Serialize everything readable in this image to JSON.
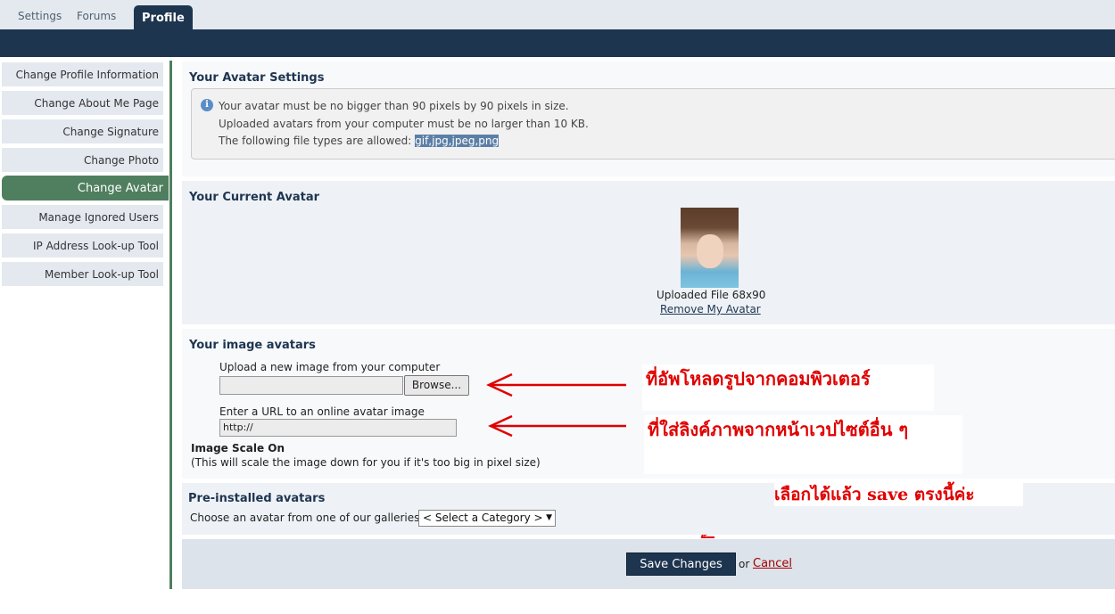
{
  "tabs": [
    {
      "label": "Settings"
    },
    {
      "label": "Forums"
    },
    {
      "label": "Profile",
      "active": true
    }
  ],
  "sidebar": {
    "items": [
      {
        "label": "Change Profile Information"
      },
      {
        "label": "Change About Me Page"
      },
      {
        "label": "Change Signature"
      },
      {
        "label": "Change Photo"
      },
      {
        "label": "Change Avatar",
        "active": true
      },
      {
        "label": "Manage Ignored Users"
      },
      {
        "label": "IP Address Look-up Tool"
      },
      {
        "label": "Member Look-up Tool"
      }
    ]
  },
  "avatar_settings": {
    "title": "Your Avatar Settings",
    "line1": "Your avatar must be no bigger than 90 pixels by 90 pixels in size.",
    "line2": "Uploaded avatars from your computer must be no larger than 10 KB.",
    "line3_prefix": "The following file types are allowed: ",
    "line3_types": "gif,jpg,jpeg,png"
  },
  "current_avatar": {
    "title": "Your Current Avatar",
    "caption": "Uploaded File 68x90",
    "remove_link": "Remove My Avatar"
  },
  "image_avatars": {
    "title": "Your image avatars",
    "upload_label": "Upload a new image from your computer",
    "browse_label": "Browse...",
    "url_label": "Enter a URL to an online avatar image",
    "url_value": "http://",
    "scale_title": "Image Scale On",
    "scale_note": "(This will scale the image down for you if it's too big in pixel size)"
  },
  "preinstalled": {
    "title": "Pre-installed avatars",
    "prompt": "Choose an avatar from one of our galleries:",
    "select_value": "< Select a Category >"
  },
  "footer": {
    "save_label": "Save Changes",
    "or_text": "or",
    "cancel_label": "Cancel"
  },
  "annotations": {
    "upload_note": "ที่อัพโหลดรูปจากคอมพิวเตอร์",
    "url_note": "ที่ใส่ลิงค์ภาพจากหน้าเวปไซต์อื่น ๆ",
    "save_note": "เลือกได้แล้ว save ตรงนี้ค่ะ",
    "color": "#e00000"
  },
  "colors": {
    "navy": "#1e3550",
    "green": "#4f7f5f",
    "panel": "#e4e9f0"
  }
}
